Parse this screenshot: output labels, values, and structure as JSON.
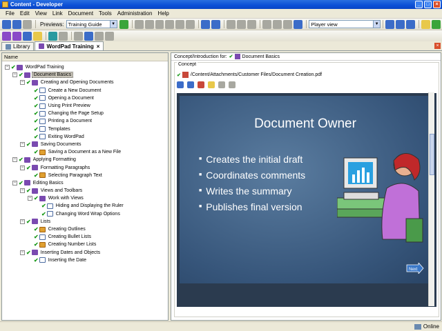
{
  "window": {
    "title": "Content - Developer"
  },
  "menu": [
    "File",
    "Edit",
    "View",
    "Link",
    "Document",
    "Tools",
    "Administration",
    "Help"
  ],
  "toolbar": {
    "previews_label": "Previews:",
    "preview_value": "Training Guide",
    "view_value": "Player view"
  },
  "tabs": [
    {
      "label": "Library",
      "active": false
    },
    {
      "label": "WordPad Training",
      "active": true
    }
  ],
  "left": {
    "column_header": "Name",
    "tree": [
      {
        "label": "WordPad Training",
        "level": 0,
        "type": "book",
        "expander": "-"
      },
      {
        "label": "Document Basics",
        "level": 1,
        "type": "book",
        "expander": "-",
        "selected": true
      },
      {
        "label": "Creating and Opening Documents",
        "level": 2,
        "type": "book",
        "expander": "-"
      },
      {
        "label": "Create a New Document",
        "level": 3,
        "type": "page"
      },
      {
        "label": "Opening a Document",
        "level": 3,
        "type": "page"
      },
      {
        "label": "Using Print Preview",
        "level": 3,
        "type": "page"
      },
      {
        "label": "Changing the Page Setup",
        "level": 3,
        "type": "page"
      },
      {
        "label": "Printing a Document",
        "level": 3,
        "type": "page"
      },
      {
        "label": "Templates",
        "level": 3,
        "type": "page"
      },
      {
        "label": "Exiting WordPad",
        "level": 3,
        "type": "page"
      },
      {
        "label": "Saving Documents",
        "level": 2,
        "type": "book",
        "expander": "-"
      },
      {
        "label": "Saving a Document as a New File",
        "level": 3,
        "type": "concept"
      },
      {
        "label": "Applying Formatting",
        "level": 1,
        "type": "book",
        "expander": "-"
      },
      {
        "label": "Formatting Paragraphs",
        "level": 2,
        "type": "book",
        "expander": "-"
      },
      {
        "label": "Selecting Paragraph Text",
        "level": 3,
        "type": "concept"
      },
      {
        "label": "Editing Basics",
        "level": 1,
        "type": "book",
        "expander": "-"
      },
      {
        "label": "Views and Toolbars",
        "level": 2,
        "type": "book",
        "expander": "-"
      },
      {
        "label": "Work with Views",
        "level": 3,
        "type": "book",
        "expander": "-"
      },
      {
        "label": "Hiding and Displaying the Ruler",
        "level": 4,
        "type": "page"
      },
      {
        "label": "Changing Word Wrap Options",
        "level": 4,
        "type": "page"
      },
      {
        "label": "Lists",
        "level": 2,
        "type": "book",
        "expander": "-"
      },
      {
        "label": "Creating Outlines",
        "level": 3,
        "type": "concept"
      },
      {
        "label": "Creating Bullet Lists",
        "level": 3,
        "type": "page"
      },
      {
        "label": "Creating Number Lists",
        "level": 3,
        "type": "concept"
      },
      {
        "label": "Inserting Dates and Objects",
        "level": 2,
        "type": "book",
        "expander": "-"
      },
      {
        "label": "Inserting the Date",
        "level": 3,
        "type": "page"
      }
    ]
  },
  "right": {
    "intro_label": "Concept/Introduction for:",
    "intro_target": "Document Basics",
    "concept_label": "Concept",
    "file_path": "/Content/Attachments/Customer Files/Document Creation.pdf",
    "slide": {
      "title": "Document Owner",
      "bullets": [
        "Creates the initial draft",
        "Coordinates comments",
        "Writes the summary",
        "Publishes final version"
      ],
      "next_label": "Next"
    }
  },
  "status": {
    "text": "Online"
  },
  "colors": {
    "titlebar": "#0b4fd6",
    "slide_bg": "#4a6a8e",
    "check": "#1a9a1a"
  }
}
